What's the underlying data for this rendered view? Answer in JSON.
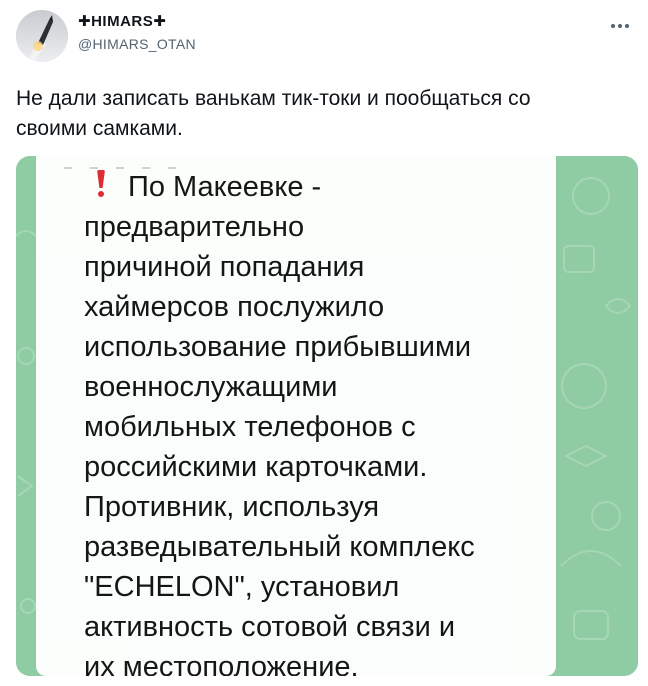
{
  "account": {
    "display_name": "✚HIMARS✚",
    "handle": "@HIMARS_OTAN",
    "avatar_icon": "rocket-launch-avatar-icon"
  },
  "menu": {
    "more_icon": "ellipsis-icon"
  },
  "tweet": {
    "text_line_1": "Не дали записать ванькам тик-токи и пообщаться со",
    "text_line_2": "своими самками."
  },
  "message": {
    "alert_icon": "red-exclamation-icon",
    "first_line": "По Макеевке -",
    "lines": [
      "предварительно",
      "причиной попадания",
      "хаймерсов послужило",
      "использование прибывшими",
      "военнослужащими",
      "мобильных телефонов с",
      "российскими карточками.",
      "Противник, используя",
      "разведывательный комплекс",
      "\"ECHELON\", установил",
      "активность сотовой связи и",
      "их местоположение."
    ]
  },
  "colors": {
    "background_green": "#8fcba3",
    "alert_red": "#e0282f",
    "handle_gray": "#536471"
  }
}
